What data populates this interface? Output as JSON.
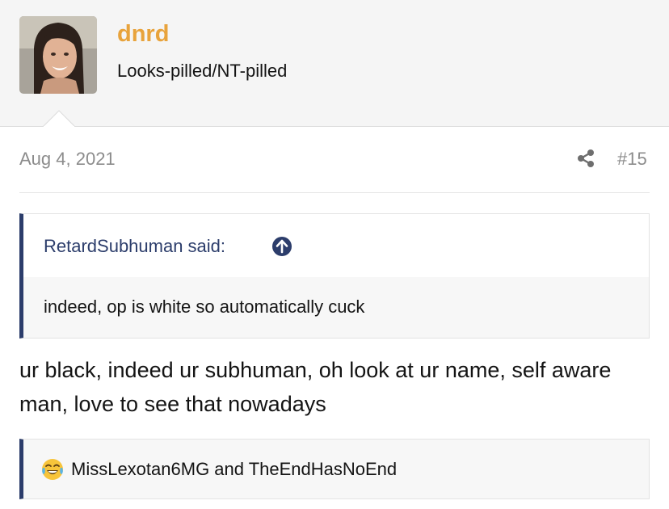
{
  "user": {
    "name": "dnrd",
    "title": "Looks-pilled/NT-pilled",
    "avatar_icon": "avatar-photo"
  },
  "post": {
    "date": "Aug 4, 2021",
    "number": "#15",
    "share_icon": "share-icon",
    "quote": {
      "author": "RetardSubhuman said:",
      "expand_icon": "arrow-up-circle-icon",
      "text": "indeed, op is white so automatically cuck"
    },
    "body": "ur black, indeed ur subhuman, oh look at ur name, self aware man, love to see that nowadays"
  },
  "reactions": {
    "emoji_icon": "tears-of-joy-emoji",
    "users": "MissLexotan6MG and TheEndHasNoEnd"
  },
  "colors": {
    "username": "#e8a33c",
    "quote_accent": "#2c3d6b",
    "muted_text": "#8c8c8c"
  }
}
